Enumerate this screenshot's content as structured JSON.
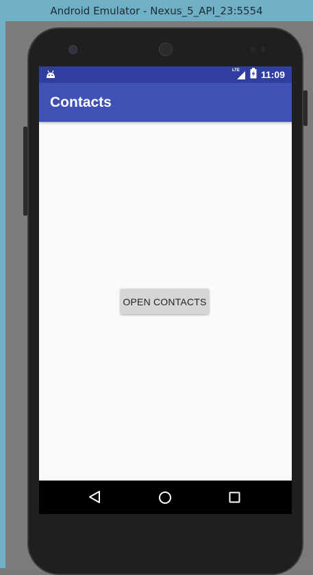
{
  "window": {
    "title": "Android Emulator - Nexus_5_API_23:5554"
  },
  "status_bar": {
    "time": "11:09",
    "network_label": "LTE",
    "icons": [
      "android-notification-icon",
      "lte-signal-icon",
      "battery-charging-icon"
    ]
  },
  "app_bar": {
    "title": "Contacts"
  },
  "main": {
    "open_contacts_label": "OPEN CONTACTS"
  },
  "nav_bar": {
    "icons": [
      "back-icon",
      "home-icon",
      "recents-icon"
    ]
  },
  "colors": {
    "status_bar": "#303f9f",
    "app_bar": "#3f51b5",
    "button": "#d6d6d6",
    "screen_background": "#fafafa"
  }
}
